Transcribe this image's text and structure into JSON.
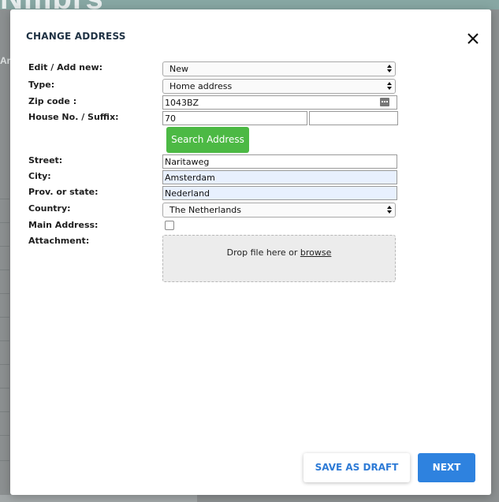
{
  "background": {
    "logo": "Nmbrs",
    "logo_mark": "®",
    "side_text": "Ar"
  },
  "dialog": {
    "title": "CHANGE ADDRESS",
    "close_icon": "close-icon"
  },
  "form": {
    "edit_add_new": {
      "label": "Edit / Add new:",
      "value": "New"
    },
    "type": {
      "label": "Type:",
      "value": "Home address"
    },
    "zip_code": {
      "label": "Zip code :",
      "value": "1043BZ"
    },
    "house_no": {
      "label": "House No. / Suffix:",
      "value": "70",
      "suffix_value": ""
    },
    "search_button": "Search Address",
    "street": {
      "label": "Street:",
      "value": "Naritaweg"
    },
    "city": {
      "label": "City:",
      "value": "Amsterdam"
    },
    "province": {
      "label": "Prov. or state:",
      "value": "Nederland"
    },
    "country": {
      "label": "Country:",
      "value": "The Netherlands"
    },
    "main_address": {
      "label": "Main Address:",
      "checked": false
    },
    "attachment": {
      "label": "Attachment:",
      "drop_text": "Drop file here or ",
      "browse_text": "browse"
    }
  },
  "footer": {
    "save_draft_label": "SAVE AS DRAFT",
    "next_label": "NEXT"
  },
  "colors": {
    "primary": "#2e82df",
    "success": "#4cb944",
    "autofill_bg": "#e8f0fe",
    "title": "#1f3244"
  }
}
